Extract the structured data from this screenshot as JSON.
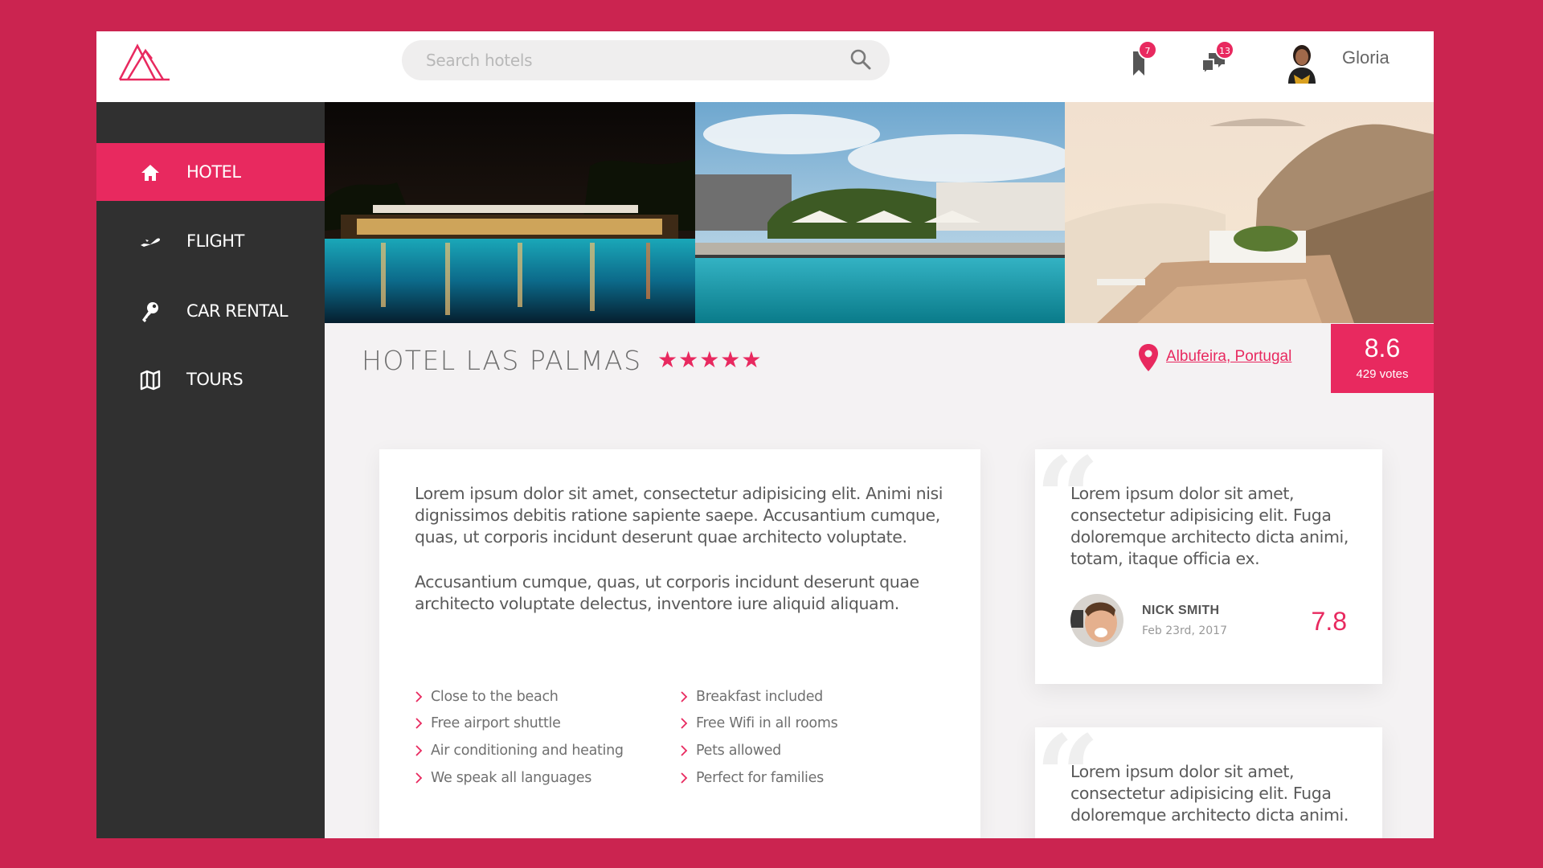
{
  "header": {
    "search_placeholder": "Search hotels",
    "bookmarks_count": "7",
    "messages_count": "13",
    "user_name": "Gloria"
  },
  "sidebar": {
    "items": [
      {
        "label": "HOTEL",
        "icon": "home-icon",
        "active": true
      },
      {
        "label": "FLIGHT",
        "icon": "plane-icon",
        "active": false
      },
      {
        "label": "CAR RENTAL",
        "icon": "key-icon",
        "active": false
      },
      {
        "label": "TOURS",
        "icon": "map-icon",
        "active": false
      }
    ]
  },
  "hotel": {
    "name": "HOTEL LAS PALMAS",
    "stars": "★★★★★",
    "location": "Albufeira, Portugal",
    "score": "8.6",
    "votes": "429 votes"
  },
  "description": {
    "paragraphs": [
      "Lorem ipsum dolor sit amet, consectetur adipisicing elit. Animi nisi dignissimos debitis ratione sapiente saepe. Accusantium cumque, quas, ut corporis incidunt deserunt quae architecto voluptate.",
      "Accusantium cumque, quas, ut corporis incidunt deserunt quae architecto voluptate delectus, inventore iure aliquid aliquam."
    ],
    "features": [
      "Close to the beach",
      "Free airport shuttle",
      "Air conditioning and heating",
      "We speak all languages",
      "Breakfast included",
      "Free Wifi in all rooms",
      "Pets allowed",
      "Perfect for families"
    ]
  },
  "reviews": [
    {
      "text": "Lorem ipsum dolor sit amet, consectetur adipisicing elit. Fuga doloremque architecto dicta animi, totam, itaque officia ex.",
      "name": "NICK SMITH",
      "date": "Feb 23rd, 2017",
      "score": "7.8"
    },
    {
      "text": "Lorem ipsum dolor sit amet, consectetur adipisicing elit. Fuga doloremque architecto dicta animi."
    }
  ],
  "colors": {
    "accent": "#e8295f",
    "page_background": "#cb2450",
    "sidebar": "#303030"
  }
}
